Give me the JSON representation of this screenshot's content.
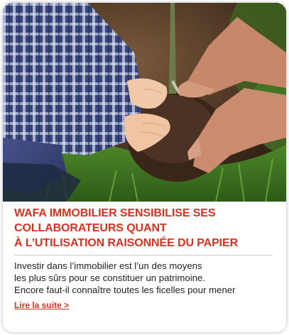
{
  "card": {
    "image": {
      "name": "tree-planting-photo"
    },
    "title_lines": [
      "WAFA IMMOBILIER SENSIBILISE SES",
      "COLLABORATEURS QUANT",
      "À L’UTILISATION RAISONNÉE DU PAPIER"
    ],
    "body_lines": [
      "Investir dans l’immobilier est l’un des moyens",
      "les plus sûrs pour se constituer un patrimoine.",
      "Encore faut-il connaître toutes les ficelles pour mener"
    ],
    "read_more_label": "Lire la suite >"
  },
  "colors": {
    "accent": "#d9311f",
    "text": "#222222"
  }
}
